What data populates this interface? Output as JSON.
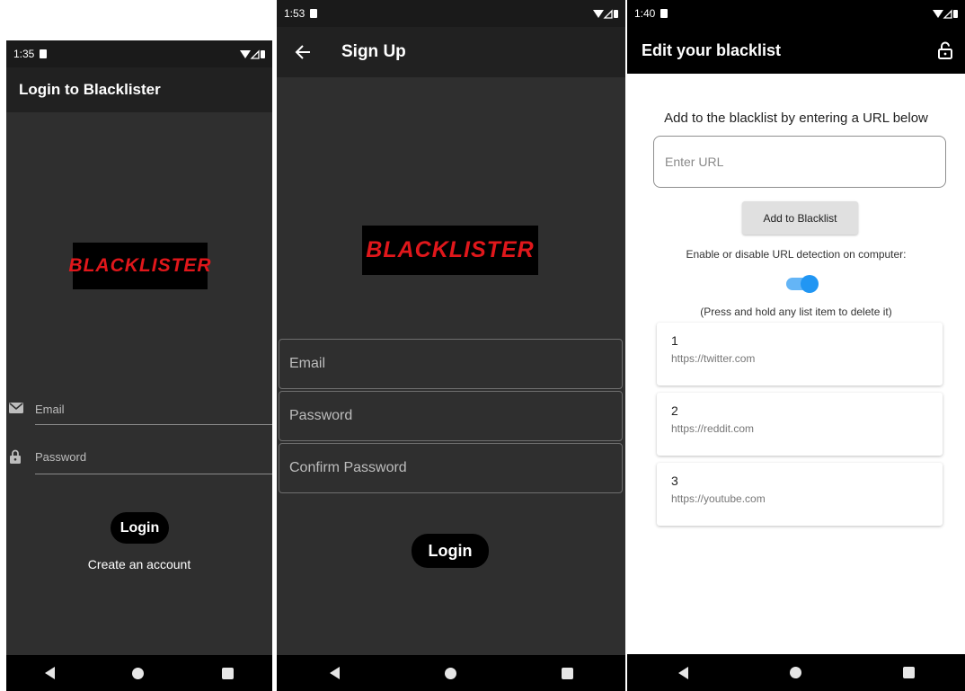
{
  "screen1": {
    "status_time": "1:35",
    "app_title": "Login to Blacklister",
    "logo_text": "BLACKLISTER",
    "email_placeholder": "Email",
    "password_placeholder": "Password",
    "login_label": "Login",
    "create_account_label": "Create an account"
  },
  "screen2": {
    "status_time": "1:53",
    "app_title": "Sign Up",
    "logo_text": "BLACKLISTER",
    "email_placeholder": "Email",
    "password_placeholder": "Password",
    "confirm_password_placeholder": "Confirm Password",
    "login_label": "Login"
  },
  "screen3": {
    "status_time": "1:40",
    "app_title": "Edit your blacklist",
    "instruction": "Add to the blacklist by entering a URL below",
    "url_placeholder": "Enter URL",
    "add_button_label": "Add to Blacklist",
    "toggle_label": "Enable or disable URL detection on computer:",
    "toggle_on": true,
    "hint": "(Press and hold any list item to delete it)",
    "items": [
      {
        "number": "1",
        "url": "https://twitter.com"
      },
      {
        "number": "2",
        "url": "https://reddit.com"
      },
      {
        "number": "3",
        "url": "https://youtube.com"
      }
    ]
  },
  "colors": {
    "dark_bg": "#2f2f2f",
    "appbar_dark": "#212121",
    "logo_red": "#e0171b",
    "toggle_blue": "#2196f3"
  }
}
